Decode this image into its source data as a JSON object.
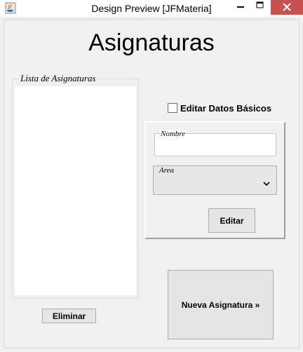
{
  "window": {
    "title": "Design Preview [JFMateria]",
    "controls": {
      "minimize": "minimize-icon",
      "maximize": "maximize-icon",
      "close": "close-icon"
    },
    "app_icon": "java-cup-icon",
    "close_color": "#c75050"
  },
  "header": {
    "title": "Asignaturas"
  },
  "list_panel": {
    "legend": "Lista de Asignaturas",
    "items": [],
    "delete_button": "Eliminar"
  },
  "details": {
    "edit_checkbox_label": "Editar Datos Básicos",
    "edit_checkbox_checked": false,
    "nombre": {
      "legend": "Nombre",
      "value": ""
    },
    "area": {
      "legend": "Area",
      "selected": ""
    },
    "edit_button": "Editar"
  },
  "actions": {
    "new_button": "Nueva Asignatura »"
  }
}
